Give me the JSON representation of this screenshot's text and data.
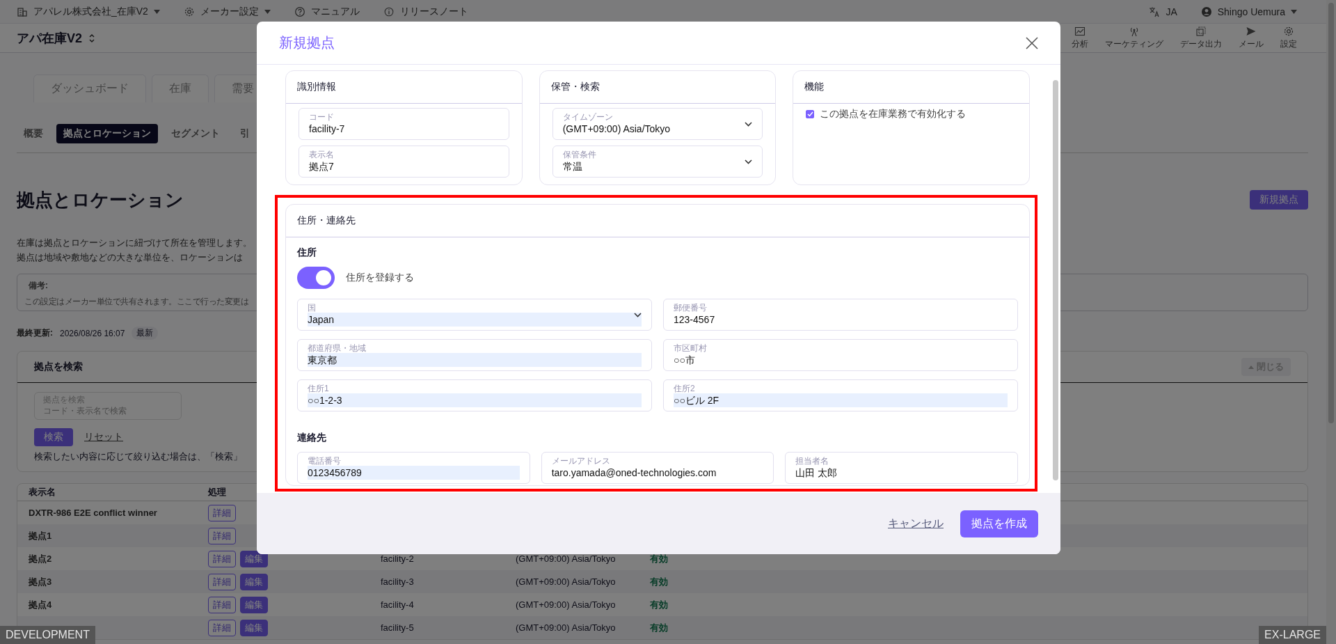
{
  "top_bar": {
    "items": [
      {
        "kind": "building",
        "label": "アパレル株式会社_在庫V2",
        "dropdown": true
      },
      {
        "kind": "gear",
        "label": "メーカー設定",
        "dropdown": true
      },
      {
        "kind": "help",
        "label": "マニュアル",
        "dropdown": false
      },
      {
        "kind": "info",
        "label": "リリースノート",
        "dropdown": false
      }
    ],
    "language": "JA",
    "user": "Shingo Uemura"
  },
  "app_header": {
    "title": "アパ在庫V2",
    "nav": [
      {
        "kind": "chart",
        "label": "分析"
      },
      {
        "kind": "antenna",
        "label": "マーケティング"
      },
      {
        "kind": "export",
        "label": "データ出力"
      },
      {
        "kind": "send",
        "label": "メール"
      },
      {
        "kind": "gear",
        "label": "設定"
      }
    ]
  },
  "main_tabs": [
    {
      "label": "ダッシュボード",
      "selected": false
    },
    {
      "label": "在庫",
      "selected": false
    },
    {
      "label": "需要",
      "selected": false
    }
  ],
  "sub_tabs": [
    {
      "label": "概要",
      "selected": false
    },
    {
      "label": "拠点とロケーション",
      "selected": true
    },
    {
      "label": "セグメント",
      "selected": false
    },
    {
      "label": "引",
      "selected": false
    }
  ],
  "page": {
    "title": "拠点とロケーション",
    "new_button": "新規拠点",
    "description": [
      "在庫は拠点とロケーションに紐づけて所在を管理します。",
      "拠点は地域や敷地などの大きな単位を、ロケーションは"
    ],
    "note": {
      "label": "備考:",
      "text": "この設定はメーカー単位で共有されます。ここで行った変更は"
    },
    "last_updated": {
      "label": "最終更新:",
      "value": "2026/08/26 16:07",
      "badge": "最新"
    }
  },
  "search": {
    "title": "拠点を検索",
    "collapse_button": "閉じる",
    "field": {
      "label": "拠点を検索",
      "placeholder": "コード・表示名で検索"
    },
    "search_button": "検索",
    "reset_link": "リセット",
    "help": "検索したい内容に応じて絞り込む場合は、「検索」"
  },
  "table": {
    "columns": [
      "表示名",
      "処理"
    ],
    "rows": [
      {
        "name": "DXTR-986 E2E conflict winner",
        "detail": "詳細"
      },
      {
        "name": "拠点1",
        "detail": "詳細"
      },
      {
        "name": "拠点2",
        "detail": "詳細",
        "edit": "編集",
        "code": "facility-2",
        "timezone": "(GMT+09:00) Asia/Tokyo",
        "status": "有効"
      },
      {
        "name": "拠点3",
        "detail": "詳細",
        "edit": "編集",
        "code": "facility-3",
        "timezone": "(GMT+09:00) Asia/Tokyo",
        "status": "有効"
      },
      {
        "name": "拠点4",
        "detail": "詳細",
        "edit": "編集",
        "code": "facility-4",
        "timezone": "(GMT+09:00) Asia/Tokyo",
        "status": "有効"
      },
      {
        "detail": "詳細",
        "edit": "編集",
        "code": "facility-5",
        "timezone": "(GMT+09:00) Asia/Tokyo",
        "status": "有効"
      }
    ]
  },
  "badges": {
    "environment": "DEVELOPMENT",
    "breakpoint": "EX-LARGE"
  },
  "dialog": {
    "title": "新規拠点",
    "cards": [
      {
        "title": "識別情報",
        "fields": [
          {
            "kind": "text",
            "label": "コード",
            "value": "facility-7",
            "autofilled": false
          },
          {
            "kind": "text",
            "label": "表示名",
            "value": "拠点7",
            "autofilled": false
          }
        ]
      },
      {
        "title": "保管・検索",
        "fields": [
          {
            "kind": "select",
            "label": "タイムゾーン",
            "value": "(GMT+09:00) Asia/Tokyo",
            "autofilled": false
          },
          {
            "kind": "select",
            "label": "保管条件",
            "value": "常温",
            "autofilled": false
          }
        ]
      },
      {
        "title": "機能",
        "checkbox": {
          "label": "この拠点を在庫業務で有効化する",
          "checked": true
        }
      }
    ],
    "address_card": {
      "title": "住所・連絡先",
      "highlighted": true,
      "address_heading": "住所",
      "toggle": {
        "label": "住所を登録する",
        "on": true
      },
      "address_fields": [
        {
          "kind": "select",
          "label": "国",
          "value": "Japan",
          "autofilled": true
        },
        {
          "kind": "text",
          "label": "郵便番号",
          "value": "123-4567",
          "autofilled": false
        },
        {
          "kind": "text",
          "label": "都道府県・地域",
          "value": "東京都",
          "autofilled": true
        },
        {
          "kind": "text",
          "label": "市区町村",
          "value": "○○市",
          "autofilled": false
        },
        {
          "kind": "text",
          "label": "住所1",
          "value": "○○1-2-3",
          "autofilled": true
        },
        {
          "kind": "text",
          "label": "住所2",
          "value": "○○ビル 2F",
          "autofilled": true
        }
      ],
      "contact_heading": "連絡先",
      "contact_fields": [
        {
          "kind": "text",
          "label": "電話番号",
          "value": "0123456789",
          "autofilled": true
        },
        {
          "kind": "text",
          "label": "メールアドレス",
          "value": "taro.yamada@oned-technologies.com",
          "autofilled": false
        },
        {
          "kind": "text",
          "label": "担当者名",
          "value": "山田 太郎",
          "autofilled": false
        }
      ]
    },
    "cancel": "キャンセル",
    "submit": "拠点を作成"
  }
}
